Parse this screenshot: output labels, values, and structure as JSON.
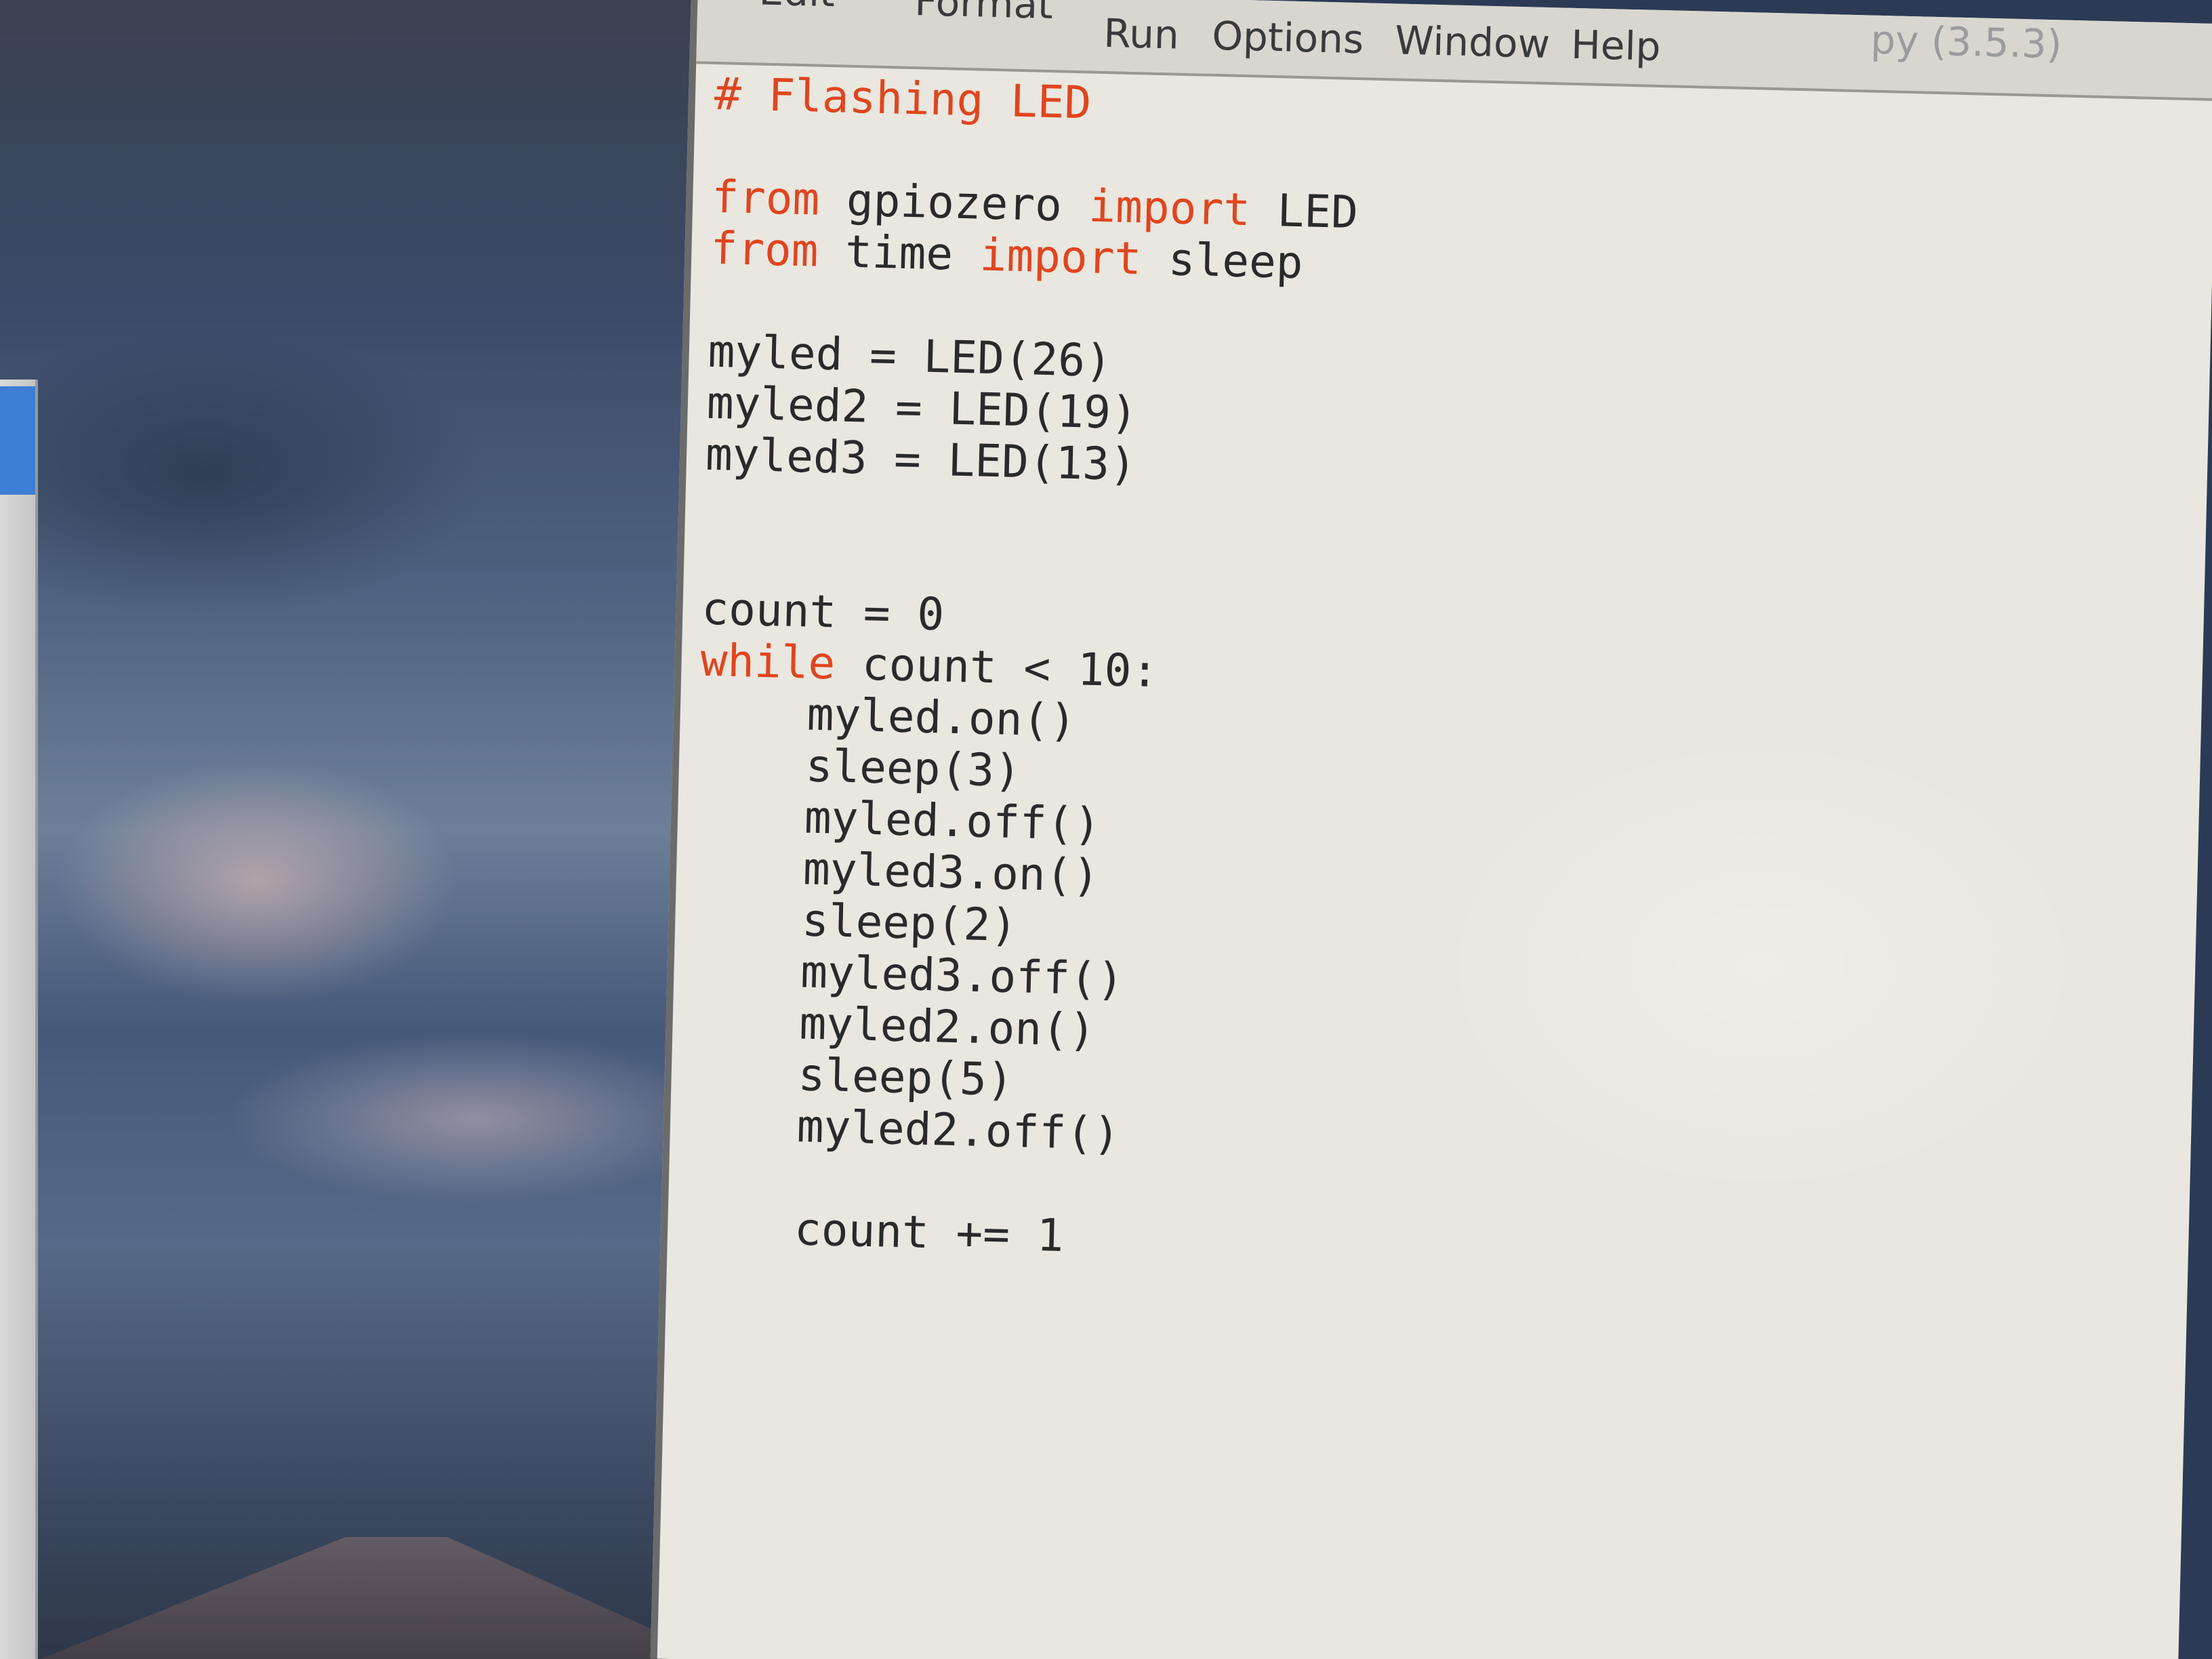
{
  "menubar": {
    "items": [
      "Edit",
      "Format",
      "Run",
      "Options",
      "Window",
      "Help"
    ],
    "title_suffix": "py (3.5.3)"
  },
  "editor": {
    "lines": [
      "# Flashing LED",
      "",
      "from gpiozero import LED",
      "from time import sleep",
      "",
      "myled = LED(26)",
      "myled2 = LED(19)",
      "myled3 = LED(13)",
      "",
      "",
      "count = 0",
      "while count < 10:",
      "    myled.on()",
      "    sleep(3)",
      "    myled.off()",
      "    myled3.on()",
      "    sleep(2)",
      "    myled3.off()",
      "    myled2.on()",
      "    sleep(5)",
      "    myled2.off()",
      "",
      "    count += 1"
    ]
  },
  "colors": {
    "keyword": "#e0451f",
    "comment": "#e0451f",
    "text": "#2a2a2a",
    "editor_bg": "#e9e7df"
  }
}
